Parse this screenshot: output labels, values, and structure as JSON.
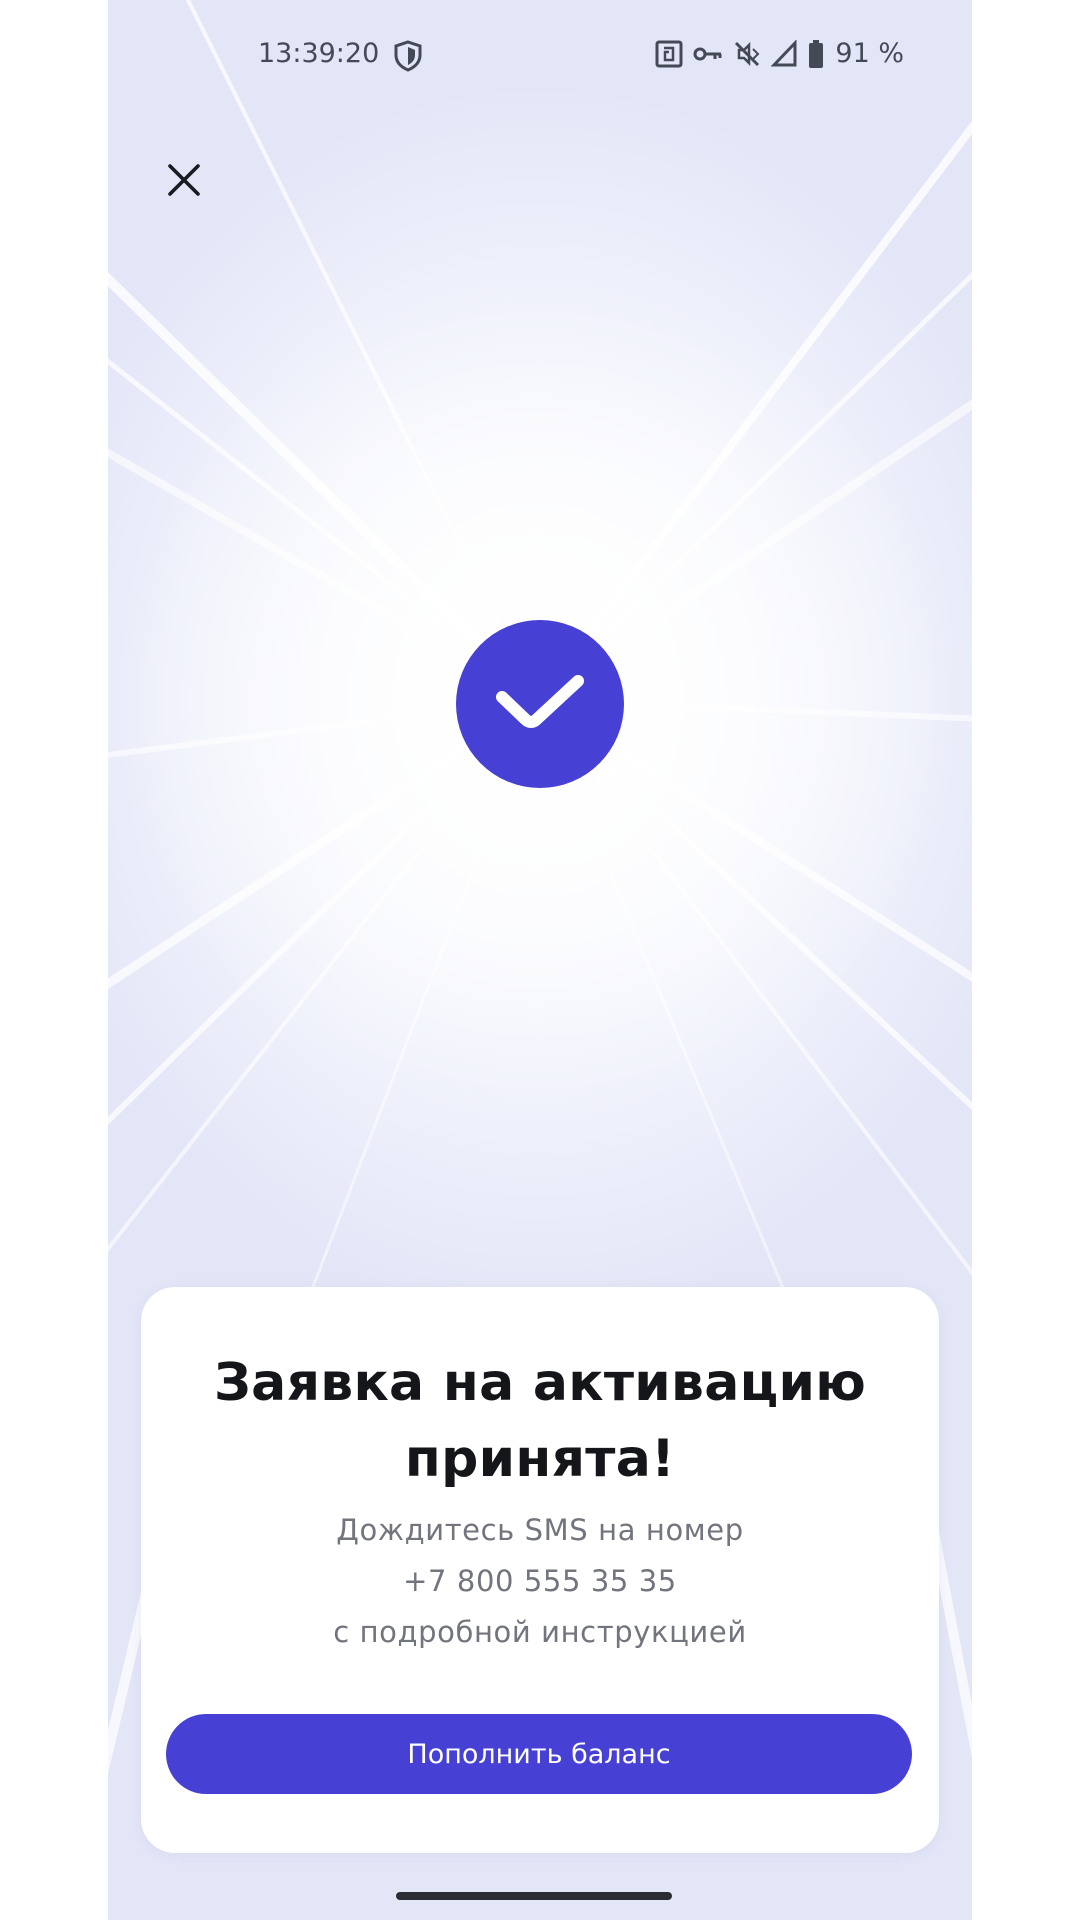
{
  "status_bar": {
    "time": "13:39:20",
    "battery": "91 %",
    "icons": [
      "shield-icon",
      "nfc-icon",
      "key-icon",
      "vibrate-off-icon",
      "signal-icon",
      "battery-icon"
    ]
  },
  "header": {
    "close_icon": "close-icon"
  },
  "hero": {
    "icon": "checkmark-icon",
    "accent_color": "#4641d4"
  },
  "card": {
    "title_line1": "Заявка на активацию",
    "title_line2": "принята!",
    "text_line1": "Дождитесь SMS на номер",
    "text_line2": "+7 800 555 35 35",
    "text_line3": "с подробной инструкцией",
    "button_label": "Пополнить баланс"
  }
}
